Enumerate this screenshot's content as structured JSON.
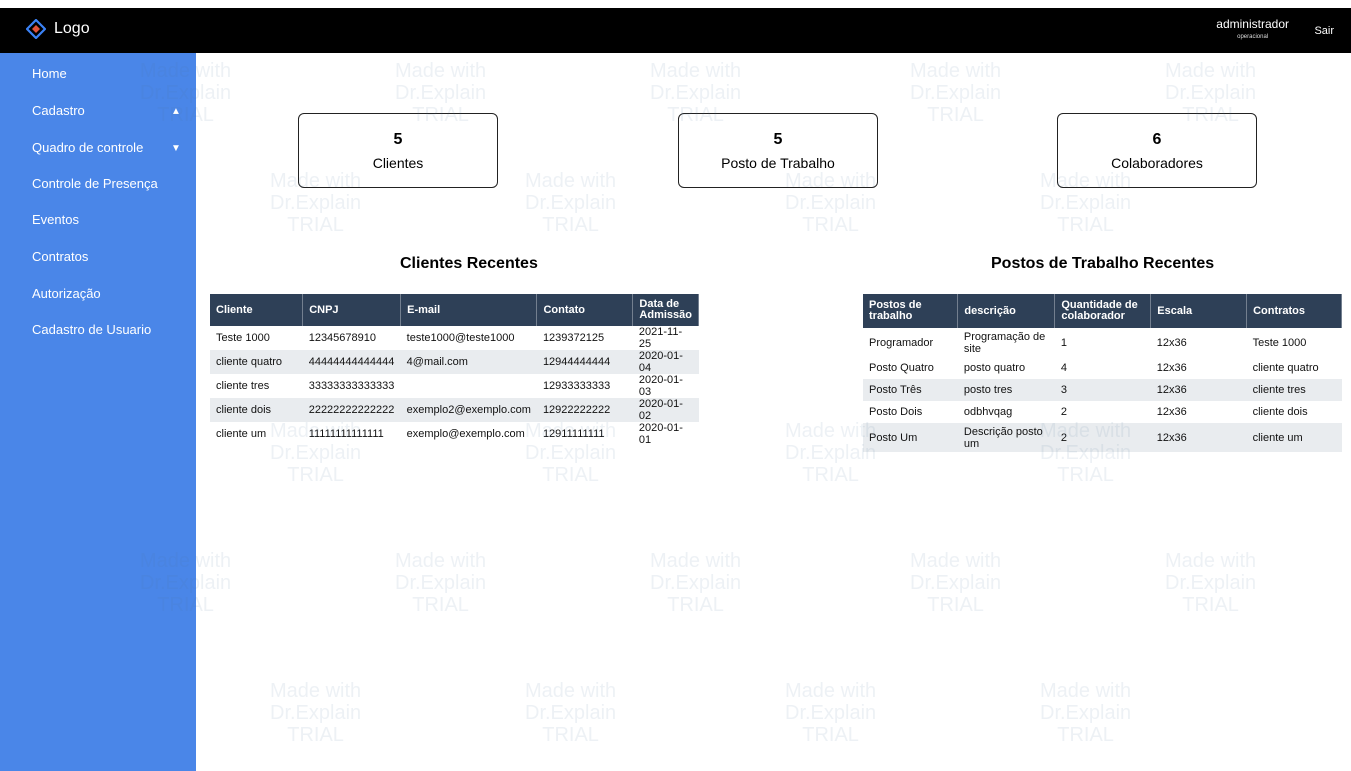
{
  "header": {
    "logo_text": "Logo",
    "logo_icon": "diamond-logo-icon",
    "user_name": "administrador",
    "user_role": "operacional",
    "logout_label": "Sair"
  },
  "sidebar": {
    "items": [
      {
        "label": "Home"
      },
      {
        "label": "Cadastro",
        "chevron": "chevron-up-icon"
      },
      {
        "label": "Quadro de controle",
        "chevron": "chevron-down-icon"
      },
      {
        "label": "Controle de Presença"
      },
      {
        "label": "Eventos"
      },
      {
        "label": "Contratos"
      },
      {
        "label": "Autorização"
      },
      {
        "label": "Cadastro de Usuario"
      }
    ]
  },
  "stats": [
    {
      "value": "5",
      "label": "Clientes"
    },
    {
      "value": "5",
      "label": "Posto de Trabalho"
    },
    {
      "value": "6",
      "label": "Colaboradores"
    }
  ],
  "clients_table": {
    "title": "Clientes Recentes",
    "headers": [
      "Cliente",
      "CNPJ",
      "E-mail",
      "Contato",
      "Data de Admissão"
    ],
    "rows": [
      [
        "Teste 1000",
        "12345678910",
        "teste1000@teste1000",
        "1239372125",
        "2021-11-25"
      ],
      [
        "cliente quatro",
        "44444444444444",
        "4@mail.com",
        "12944444444",
        "2020-01-04"
      ],
      [
        "cliente tres",
        "33333333333333",
        "",
        "12933333333",
        "2020-01-03"
      ],
      [
        "cliente dois",
        "22222222222222",
        "exemplo2@exemplo.com",
        "12922222222",
        "2020-01-02"
      ],
      [
        "cliente um",
        "11111111111111",
        "exemplo@exemplo.com",
        "12911111111",
        "2020-01-01"
      ]
    ]
  },
  "posts_table": {
    "title": "Postos de Trabalho Recentes",
    "headers": [
      "Postos de trabalho",
      "descrição",
      "Quantidade de colaborador",
      "Escala",
      "Contratos"
    ],
    "rows": [
      [
        "Programador",
        "Programação de site",
        "1",
        "12x36",
        "Teste 1000"
      ],
      [
        "Posto Quatro",
        "posto quatro",
        "4",
        "12x36",
        "cliente quatro"
      ],
      [
        "Posto Três",
        "posto tres",
        "3",
        "12x36",
        "cliente tres"
      ],
      [
        "Posto Dois",
        "odbhvqag",
        "2",
        "12x36",
        "cliente dois"
      ],
      [
        "Posto Um",
        "Descrição posto um",
        "2",
        "12x36",
        "cliente um"
      ]
    ]
  },
  "watermark": {
    "line1": "Made with",
    "line2": "Dr.Explain",
    "line3": "TRIAL"
  }
}
